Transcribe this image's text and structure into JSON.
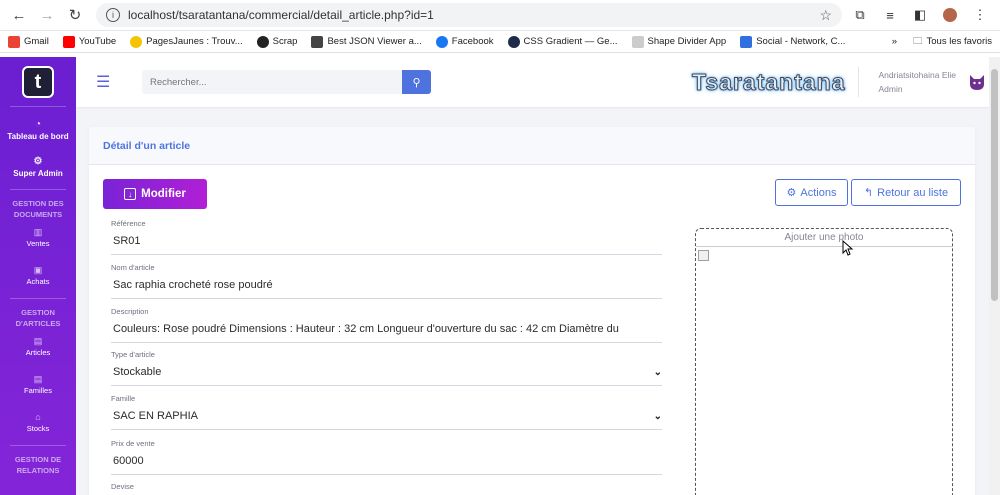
{
  "browser": {
    "url": "localhost/tsaratantana/commercial/detail_article.php?id=1",
    "bookmarks": [
      {
        "label": "Gmail",
        "color": "#ea4335"
      },
      {
        "label": "YouTube",
        "color": "#ff0000"
      },
      {
        "label": "PagesJaunes : Trouv...",
        "color": "#f5c400"
      },
      {
        "label": "Scrap",
        "color": "#222222"
      },
      {
        "label": "Best JSON Viewer a...",
        "color": "#444444"
      },
      {
        "label": "Facebook",
        "color": "#1877f2"
      },
      {
        "label": "CSS Gradient — Ge...",
        "color": "#1e2a4a"
      },
      {
        "label": "Shape Divider App",
        "color": "#cccccc"
      },
      {
        "label": "Social - Network, C...",
        "color": "#2f6fe0"
      }
    ],
    "favorites_label": "Tous les favoris"
  },
  "sidebar": {
    "logo_letter": "t",
    "dashboard": "Tableau de bord",
    "super_admin": "Super Admin",
    "sec_documents": "GESTION DES DOCUMENTS",
    "ventes": "Ventes",
    "achats": "Achats",
    "sec_articles": "GESTION D'ARTICLES",
    "articles": "Articles",
    "familles": "Familles",
    "stocks": "Stocks",
    "sec_relations": "GESTION DE RELATIONS"
  },
  "topbar": {
    "search_placeholder": "Rechercher...",
    "brand": "Tsaratantana",
    "user_name": "Andriatsitohaina Elie",
    "user_role": "Admin"
  },
  "card": {
    "title": "Détail d'un article",
    "modify_label": "Modifier",
    "actions_label": "Actions",
    "back_label": "Retour au liste",
    "photo_label": "Ajouter une photo"
  },
  "fields": {
    "ref_label": "Référence",
    "ref_value": "SR01",
    "name_label": "Nom d'article",
    "name_value": "Sac raphia crocheté rose poudré",
    "desc_label": "Description",
    "desc_value": "Couleurs: Rose poudré  Dimensions : Hauteur : 32 cm  Longueur d'ouverture du sac : 42 cm  Diamètre du",
    "type_label": "Type d'article",
    "type_value": "Stockable",
    "family_label": "Famille",
    "family_value": "SAC EN RAPHIA",
    "price_label": "Prix de vente",
    "price_value": "60000",
    "currency_label": "Devise"
  },
  "colors": {
    "sidebar": "#6a1fd1",
    "primary": "#4e73df",
    "modify_gradient_start": "#7a23d6",
    "modify_gradient_end": "#b11fd6"
  }
}
